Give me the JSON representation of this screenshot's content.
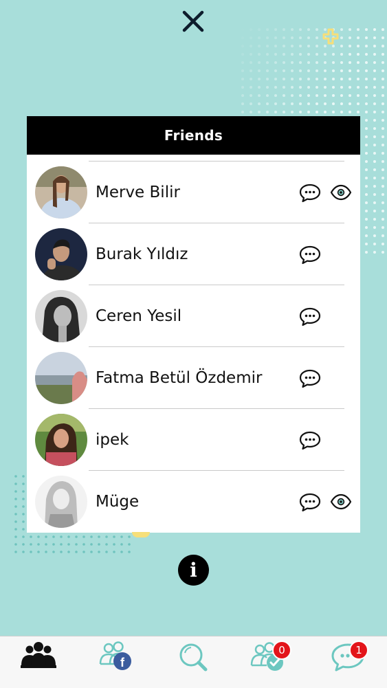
{
  "modal": {
    "title": "Friends"
  },
  "friends": [
    {
      "name": "Merve Bilir",
      "avatar": "avatar-merve",
      "icons": [
        "chat-icon",
        "eye-icon"
      ]
    },
    {
      "name": "Burak Yıldız",
      "avatar": "avatar-burak",
      "icons": [
        "chat-icon"
      ]
    },
    {
      "name": "Ceren Yesil",
      "avatar": "avatar-ceren",
      "icons": [
        "chat-icon"
      ]
    },
    {
      "name": "Fatma Betül Özdemir",
      "avatar": "avatar-fatma",
      "icons": [
        "chat-icon"
      ]
    },
    {
      "name": "ipek",
      "avatar": "avatar-ipek",
      "icons": [
        "chat-icon"
      ]
    },
    {
      "name": "Müge",
      "avatar": "avatar-muge",
      "icons": [
        "chat-icon",
        "eye-icon"
      ]
    }
  ],
  "tabbar": {
    "tabs": [
      {
        "icon": "friends-group-icon",
        "active": true
      },
      {
        "icon": "facebook-friends-icon",
        "active": false
      },
      {
        "icon": "search-icon",
        "active": false
      },
      {
        "icon": "friend-requests-icon",
        "badge": "0"
      },
      {
        "icon": "messages-icon",
        "badge": "1"
      }
    ]
  },
  "colors": {
    "background": "#a8deda",
    "teal": "#6cc7c0",
    "header": "#000000",
    "badge": "#e3151a",
    "accent_yellow": "#f6df7a"
  }
}
